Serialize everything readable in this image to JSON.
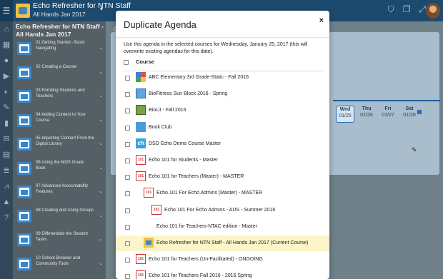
{
  "topbar": {
    "menu_icon": "hamburger-menu-icon",
    "course_title": "Echo Refresher for NTN Staff",
    "course_subtitle": "All Hands Jan 2017",
    "caret": "▾",
    "icons": [
      "filter-icon",
      "copy-icon",
      "expand-icon"
    ]
  },
  "rail": {
    "icons": [
      "home-icon",
      "calendar-icon",
      "users-icon",
      "play-icon",
      "dashboard-icon",
      "pencil-icon",
      "bookmark-icon",
      "mail-icon",
      "documents-icon",
      "list-icon",
      "chart-icon",
      "warning-icon",
      "help-icon"
    ]
  },
  "sidebar": {
    "title": "Echo Refresher for NTN Staff - All Hands Jan 2017",
    "units": [
      {
        "label": "01 Getting Started - Basic Navigating"
      },
      {
        "label": "02 Creating a Course"
      },
      {
        "label": "03 Enrolling Students and Teachers"
      },
      {
        "label": "04 Adding Content to Your Course"
      },
      {
        "label": "05 Importing Content From the Digital Library"
      },
      {
        "label": "06 Using the MOS Grade Book"
      },
      {
        "label": "07 Advanced Accountability Features"
      },
      {
        "label": "08 Creating and Using Groups"
      },
      {
        "label": "09 Differentiate the Student Tasks"
      },
      {
        "label": "10 School Browser and Community Tools"
      }
    ]
  },
  "calendar": {
    "days": [
      {
        "name": "Wed",
        "date": "01/25",
        "active": true
      },
      {
        "name": "Thu",
        "date": "01/26",
        "active": false
      },
      {
        "name": "Fri",
        "date": "01/27",
        "active": false
      },
      {
        "name": "Sat",
        "date": "01/28",
        "active": false
      }
    ]
  },
  "modal": {
    "title": "Duplicate Agenda",
    "close": "×",
    "description": "Use this agenda in the selected courses for Wednesday, January 25, 2017 (this will overwrite existing agendas for this date).",
    "column_header": "Course",
    "courses": [
      {
        "label": "ABC Elementary 3rd Grade-Static - Fall 2016",
        "thumb": "abc",
        "indent": 0,
        "highlighted": false
      },
      {
        "label": "BioFitness Sun Block 2016 - Spring",
        "thumb": "bio",
        "indent": 0,
        "highlighted": false
      },
      {
        "label": "BioLit - Fall 2016",
        "thumb": "biolit",
        "indent": 0,
        "highlighted": false
      },
      {
        "label": "Book Club",
        "thumb": "book",
        "indent": 0,
        "highlighted": false
      },
      {
        "label": "DSD Echo Demo Course Master",
        "thumb": "dsd",
        "indent": 0,
        "highlighted": false
      },
      {
        "label": "Echo 101 for Students - Master",
        "thumb": "101",
        "indent": 0,
        "highlighted": false
      },
      {
        "label": "Echo 101 for Teachers (Master) - MASTER",
        "thumb": "101",
        "indent": 0,
        "highlighted": false
      },
      {
        "label": "Echo 101 For Echo Admins (Master) - MASTER",
        "thumb": "101",
        "indent": 1,
        "highlighted": false
      },
      {
        "label": "Echo 101 For Echo Admins - AUS - Summer 2016",
        "thumb": "101",
        "indent": 2,
        "highlighted": false
      },
      {
        "label": "Echo 101 for Teachers-NTAC edition - Master",
        "thumb": "none",
        "indent": 1,
        "highlighted": false
      },
      {
        "label": "Echo Refresher for NTN Staff - All Hands Jan 2017  (Current Course)",
        "thumb": "echo",
        "indent": 1,
        "highlighted": true
      },
      {
        "label": "Echo 101 for Teachers (Un-Facilitated) - ONGOING",
        "thumb": "101",
        "indent": 0,
        "highlighted": false
      },
      {
        "label": "Echo 101 for Teachers Fall 2016 - 2016 Spring",
        "thumb": "101",
        "indent": 0,
        "highlighted": false
      }
    ]
  }
}
